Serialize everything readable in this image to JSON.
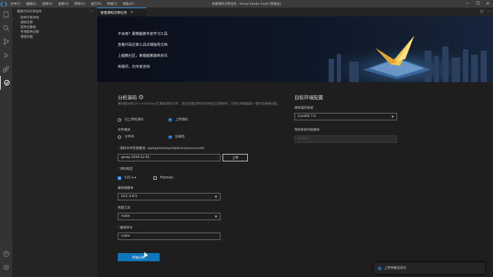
{
  "titlebar": {
    "menu": [
      "文件(F)",
      "编辑(E)",
      "选择(S)",
      "查看(V)",
      "转到(G)",
      "运行(R)",
      "终端(T)",
      "帮助(H)"
    ],
    "title": "新建源码迁移任务 - Visual Studio Code [管理员]"
  },
  "sidebar": {
    "header": "鲲鹏代码迁移插件",
    "items": [
      "软件迁移评估",
      "源码迁移",
      "软件包重构",
      "专项软件迁移",
      "增强功能"
    ]
  },
  "tab": {
    "label": "新建源码迁移任务",
    "close": "×"
  },
  "banner": {
    "links": [
      "不会用？跟着鲲鹏专家学习工具",
      "查看代码迁移工具详细指导文档",
      "上鲲鹏社区，掌握鲲鹏最新资讯",
      "有疑问，向专家咨询"
    ]
  },
  "analyze": {
    "title": "分析源码",
    "description": "将扫描分析C/C++/Fortran/汇编等源码文件，定位出需迁移代码并给出迁移指导，支持迁移编辑及一键代码替换功能。",
    "source_option_1": "已上传的源码",
    "source_option_2": "上传源码",
    "file_mode_label": "文件模式",
    "file_mode_1": "文件夹",
    "file_mode_2": "压缩包",
    "path_label": "源码文件存放路径: /opt/portadv/portadmin/sourcecode/",
    "path_value": "gmap-2019-12-01.",
    "upload_button": "上传",
    "source_type_label": "源码类型",
    "type_c": "C/C++",
    "type_fortran": "Fortran",
    "compiler_version_label": "编译器版本",
    "compiler_version_value": "GCC 4.8.5",
    "build_tool_label": "构建工具",
    "build_tool_value": "make",
    "build_cmd_label": "编译命令",
    "build_cmd_value": "make",
    "start_button": "开始分析"
  },
  "target": {
    "title": "目标环境配置",
    "os_label": "目标操作系统",
    "os_value": "CentOS 7.6",
    "kernel_label": "目标系统内核版本",
    "kernel_value": "4.14.0"
  },
  "toast": {
    "message": "上传并解压成功"
  },
  "colors": {
    "accent": "#1177bb",
    "radio_selected": "#3794ff",
    "required": "#e04848"
  }
}
